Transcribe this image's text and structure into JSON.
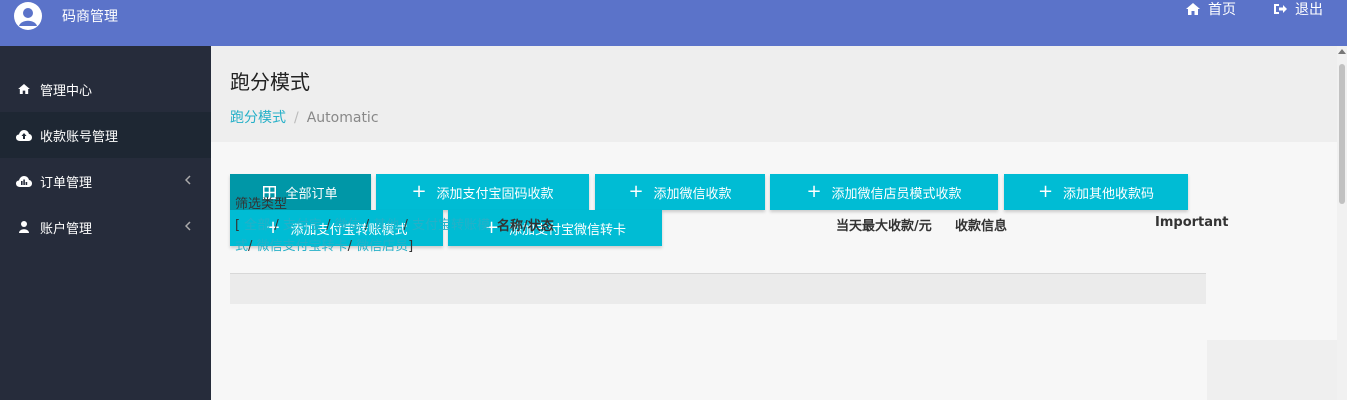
{
  "header": {
    "brand_title": "码商管理",
    "links": [
      {
        "label": "首页",
        "icon": "home-icon"
      },
      {
        "label": "退出",
        "icon": "logout-icon"
      }
    ]
  },
  "sidebar": {
    "items": [
      {
        "label": "管理中心",
        "icon": "home-icon"
      },
      {
        "label": "收款账号管理",
        "icon": "cloud-upload-icon",
        "active": true
      },
      {
        "label": "订单管理",
        "icon": "chart-icon",
        "has_children": true
      },
      {
        "label": "账户管理",
        "icon": "user-icon",
        "has_children": true
      }
    ]
  },
  "page": {
    "title": "跑分模式",
    "breadcrumb": {
      "link": "跑分模式",
      "separator": "/",
      "current": "Automatic"
    }
  },
  "buttons": [
    {
      "label": "全部订单",
      "icon": "grid-icon"
    },
    {
      "label": "添加支付宝固码收款",
      "icon": "plus-icon"
    },
    {
      "label": "添加微信收款",
      "icon": "plus-icon"
    },
    {
      "label": "添加微信店员模式收款",
      "icon": "plus-icon"
    },
    {
      "label": "添加其他收款码",
      "icon": "plus-icon"
    },
    {
      "label": "添加支付宝转账模式",
      "icon": "plus-icon"
    },
    {
      "label": "添加支付宝微信转卡",
      "icon": "plus-icon"
    }
  ],
  "plus_glyph": "+",
  "filter": {
    "label": "筛选类型",
    "open": "[",
    "close": "]",
    "sep": "/",
    "options": [
      "全部",
      "支付宝",
      "微信",
      "其他",
      "支付宝转账模式",
      "微信支付宝转卡",
      "微信店员"
    ]
  },
  "table": {
    "headers": [
      "名称/状态",
      "当天最大收款/元",
      "收款信息",
      "Important"
    ]
  },
  "colors": {
    "header": "#5b73c9",
    "sidebar": "#262c3b",
    "accent": "#00bcd4",
    "accent_dark": "#0097a7",
    "link": "#26b0c8"
  }
}
